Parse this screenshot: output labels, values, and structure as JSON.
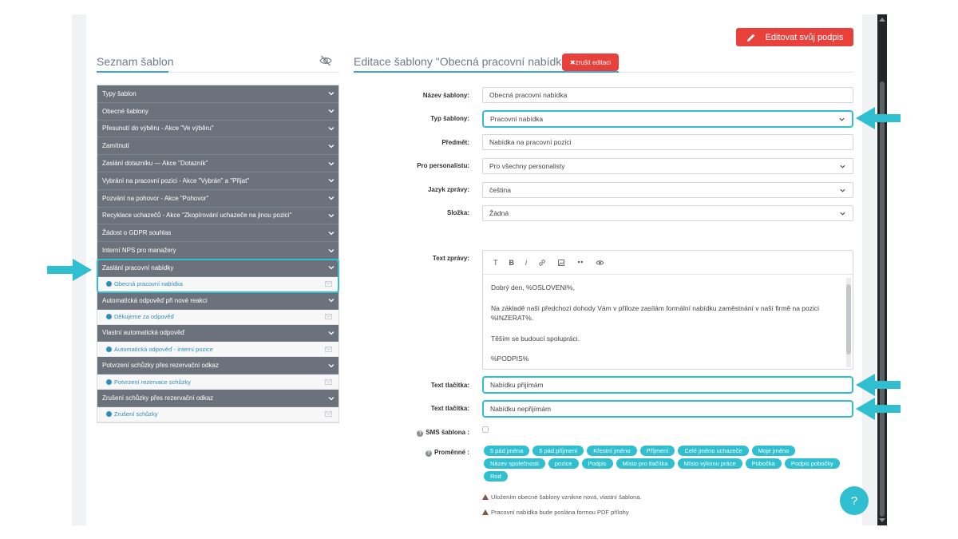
{
  "header": {
    "edit_signature_label": "Editovat svůj podpis"
  },
  "left_panel": {
    "title": "Seznam šablon",
    "hide_icon": "eye-off-icon",
    "tree": [
      {
        "label": "Typy šablon",
        "subs": []
      },
      {
        "label": "Obecné šablony",
        "subs": []
      },
      {
        "label": "Přesunutí do výběru - Akce \"Ve výběru\"",
        "subs": []
      },
      {
        "label": "Zamítnutí",
        "subs": []
      },
      {
        "label": "Zaslání dotazníku — Akce \"Dotazník\"",
        "subs": []
      },
      {
        "label": "Vybrání na pracovní pozici - Akce \"Vybrán\" a \"Přijat\"",
        "subs": []
      },
      {
        "label": "Pozvání na pohovor - Akce \"Pohovor\"",
        "subs": []
      },
      {
        "label": "Recyklace uchazečů - Akce \"Zkopírování uchazeče na jinou pozici\"",
        "subs": []
      },
      {
        "label": "Žádost o GDPR souhlas",
        "subs": []
      },
      {
        "label": "Interní NPS pro manažery",
        "subs": []
      },
      {
        "label": "Zaslání pracovní nabídky",
        "subs": [
          "Obecná pracovní nabídka"
        ],
        "highlighted": true
      },
      {
        "label": "Automatická odpověď při nové reakci",
        "subs": [
          "Děkujeme za odpověď"
        ]
      },
      {
        "label": "Vlastní automatická odpověď",
        "subs": [
          "Automatická odpověď - interní pozice"
        ]
      },
      {
        "label": "Potvrzení schůzky přes rezervační odkaz",
        "subs": [
          "Potvrzení rezervace schůzky"
        ]
      },
      {
        "label": "Zrušení schůzky přes rezervační odkaz",
        "subs": [
          "Zrušení schůzky"
        ]
      }
    ]
  },
  "right_panel": {
    "title": "Editace šablony \"Obecná pracovní nabídka\"",
    "cancel_label": "✖zrušit editaci",
    "fields": {
      "name": {
        "label": "Název šablony:",
        "value": "Obecná pracovní nabídka"
      },
      "type": {
        "label": "Typ šablony:",
        "value": "Pracovní nabídka"
      },
      "subject": {
        "label": "Předmět:",
        "value": "Nabídka na pracovní pozici"
      },
      "personalist": {
        "label": "Pro personalistu:",
        "value": "Pro všechny personalisty"
      },
      "language": {
        "label": "Jazyk zprávy:",
        "value": "čeština"
      },
      "folder": {
        "label": "Složka:",
        "value": "Žádná"
      }
    },
    "message": {
      "label": "Text zprávy:",
      "toolbar": [
        "T",
        "B",
        "i"
      ],
      "lines": [
        "Dobrý den, %OSLOVENI%,",
        "Na základě naší předchozí dohody Vám v příloze zasílám formální nabídku zaměstnání v naší firmě na pozici %INZERAT%.",
        "Těším se budoucí spolupráci.",
        "%PODPIS%"
      ]
    },
    "button_text_1": {
      "label": "Text tlačítka:",
      "value": "Nabídku přijímám"
    },
    "button_text_2": {
      "label": "Text tlačítka:",
      "value": "Nabídku nepřijímám"
    },
    "sms": {
      "label": "SMS šablona :"
    },
    "variables": {
      "label": "Proměnné :",
      "items": [
        "5 pád jména",
        "5 pád příjmení",
        "Křestní jméno",
        "Příjmení",
        "Celé jméno uchazeče",
        "Moje jméno",
        "Název společnosti",
        "pozice",
        "Podpis",
        "Místo pro tlačítka",
        "Místo výkonu práce",
        "Pobočka",
        "Podpis pobočky",
        "Rod"
      ]
    },
    "notes": [
      "Uložením obecné šablony vznikne nová, vlastní šablona.",
      "Pracovní nabídka bude poslána formou PDF přílohy"
    ]
  },
  "help_label": "?",
  "colors": {
    "accent": "#2fbfd0",
    "danger": "#e8403a",
    "category": "#6c727c",
    "link": "#2d8fbf"
  }
}
